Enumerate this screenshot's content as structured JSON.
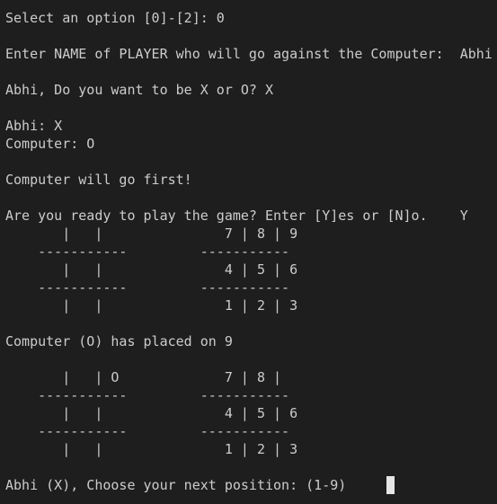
{
  "lines": [
    "Select an option [0]-[2]: 0",
    "",
    "Enter NAME of PLAYER who will go against the Computer:  Abhi",
    "",
    "Abhi, Do you want to be X or O? X",
    "",
    "Abhi: X",
    "Computer: O",
    "",
    "Computer will go first!",
    "",
    "Are you ready to play the game? Enter [Y]es or [N]o.    Y",
    "       |   |               7 | 8 | 9",
    "    -----------         -----------",
    "       |   |               4 | 5 | 6",
    "    -----------         -----------",
    "       |   |               1 | 2 | 3",
    "",
    "Computer (O) has placed on 9",
    "",
    "       |   | O             7 | 8 |",
    "    -----------         -----------",
    "       |   |               4 | 5 | 6",
    "    -----------         -----------",
    "       |   |               1 | 2 | 3",
    "",
    "Abhi (X), Choose your next position: (1-9)     "
  ]
}
